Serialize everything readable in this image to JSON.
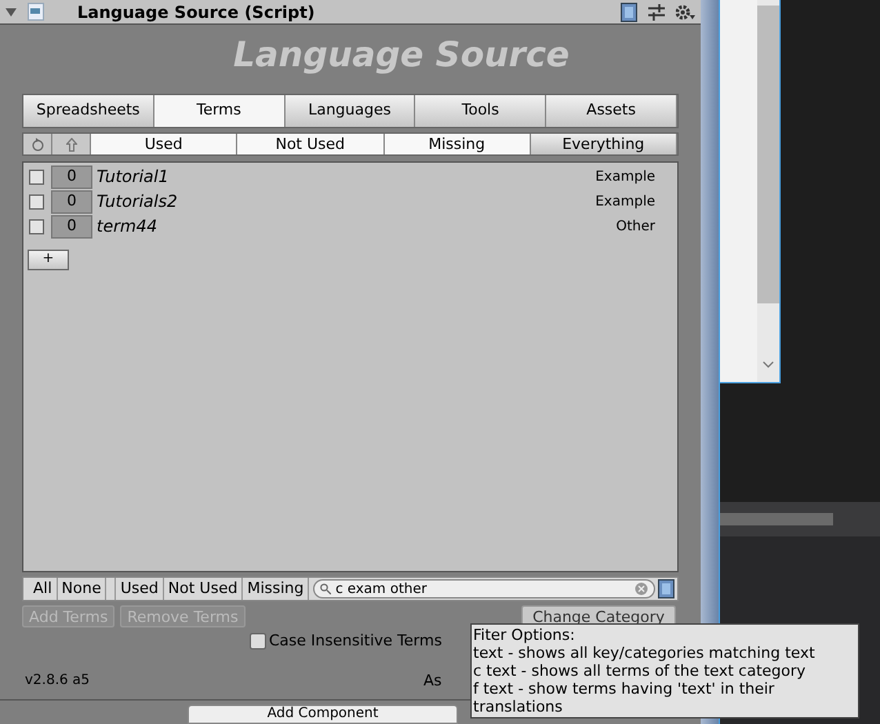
{
  "component": {
    "title": "Language Source (Script)",
    "expanded": true
  },
  "header": "Language Source",
  "tabs": [
    {
      "label": "Spreadsheets",
      "selected": false
    },
    {
      "label": "Terms",
      "selected": true
    },
    {
      "label": "Languages",
      "selected": false
    },
    {
      "label": "Tools",
      "selected": false
    },
    {
      "label": "Assets",
      "selected": false
    }
  ],
  "filters": [
    {
      "label": "Used",
      "selected": true
    },
    {
      "label": "Not Used",
      "selected": true
    },
    {
      "label": "Missing",
      "selected": true
    },
    {
      "label": "Everything",
      "selected": false
    }
  ],
  "terms": [
    {
      "checked": false,
      "count": "0",
      "name": "Tutorial1",
      "category": "Example"
    },
    {
      "checked": false,
      "count": "0",
      "name": "Tutorials2",
      "category": "Example"
    },
    {
      "checked": false,
      "count": "0",
      "name": "term44",
      "category": "Other"
    }
  ],
  "add_row": "+",
  "bottom_filters": [
    "All",
    "None",
    "Used",
    "Not Used",
    "Missing"
  ],
  "search": {
    "value": "c exam other"
  },
  "buttons": [
    {
      "label": "Add Terms",
      "disabled": true
    },
    {
      "label": "Remove Terms",
      "disabled": true
    },
    {
      "label": "Change Category",
      "disabled": false
    }
  ],
  "case_insensitive": {
    "label": "Case Insensitive Terms",
    "checked": false
  },
  "version": "v2.8.6 a5",
  "footer_text": "As",
  "tooltip": [
    "Fiter Options:",
    "text - shows all key/categories matching text",
    "c text - shows all terms of the text category",
    "f text - show terms having 'text' in their translations"
  ],
  "add_component": "Add Component"
}
